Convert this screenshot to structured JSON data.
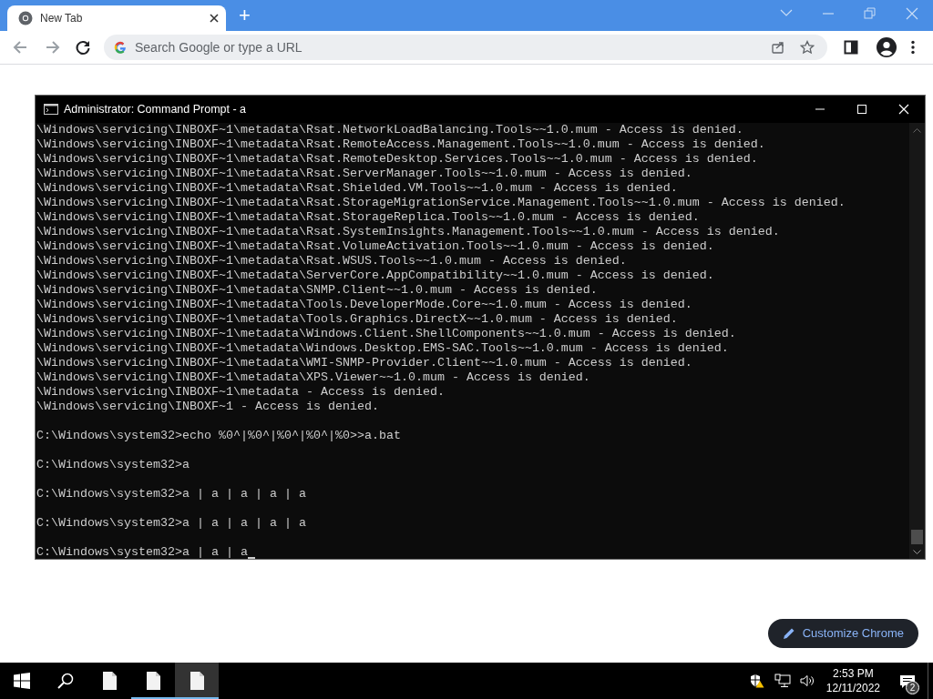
{
  "browser": {
    "tab": {
      "title": "New Tab",
      "selected": true
    },
    "new_tab_button": "+",
    "nav_buttons": [
      {
        "kind": "back",
        "disabled": true
      },
      {
        "kind": "forward",
        "disabled": true
      },
      {
        "kind": "reload",
        "disabled": false
      }
    ],
    "address_bar": {
      "placeholder": "Search Google or type a URL"
    },
    "customize_button": "Customize Chrome"
  },
  "console_window": {
    "title": "Administrator: Command Prompt - a",
    "blocks": [
      [
        "\\Windows\\servicing\\INBOXF~1\\metadata\\Rsat.NetworkLoadBalancing.Tools~~1.0.mum - Access is denied.",
        "\\Windows\\servicing\\INBOXF~1\\metadata\\Rsat.RemoteAccess.Management.Tools~~1.0.mum - Access is denied.",
        "\\Windows\\servicing\\INBOXF~1\\metadata\\Rsat.RemoteDesktop.Services.Tools~~1.0.mum - Access is denied.",
        "\\Windows\\servicing\\INBOXF~1\\metadata\\Rsat.ServerManager.Tools~~1.0.mum - Access is denied.",
        "\\Windows\\servicing\\INBOXF~1\\metadata\\Rsat.Shielded.VM.Tools~~1.0.mum - Access is denied.",
        "\\Windows\\servicing\\INBOXF~1\\metadata\\Rsat.StorageMigrationService.Management.Tools~~1.0.mum - Access is denied.",
        "\\Windows\\servicing\\INBOXF~1\\metadata\\Rsat.StorageReplica.Tools~~1.0.mum - Access is denied.",
        "\\Windows\\servicing\\INBOXF~1\\metadata\\Rsat.SystemInsights.Management.Tools~~1.0.mum - Access is denied.",
        "\\Windows\\servicing\\INBOXF~1\\metadata\\Rsat.VolumeActivation.Tools~~1.0.mum - Access is denied.",
        "\\Windows\\servicing\\INBOXF~1\\metadata\\Rsat.WSUS.Tools~~1.0.mum - Access is denied.",
        "\\Windows\\servicing\\INBOXF~1\\metadata\\ServerCore.AppCompatibility~~1.0.mum - Access is denied.",
        "\\Windows\\servicing\\INBOXF~1\\metadata\\SNMP.Client~~1.0.mum - Access is denied.",
        "\\Windows\\servicing\\INBOXF~1\\metadata\\Tools.DeveloperMode.Core~~1.0.mum - Access is denied.",
        "\\Windows\\servicing\\INBOXF~1\\metadata\\Tools.Graphics.DirectX~~1.0.mum - Access is denied.",
        "\\Windows\\servicing\\INBOXF~1\\metadata\\Windows.Client.ShellComponents~~1.0.mum - Access is denied.",
        "\\Windows\\servicing\\INBOXF~1\\metadata\\Windows.Desktop.EMS-SAC.Tools~~1.0.mum - Access is denied.",
        "\\Windows\\servicing\\INBOXF~1\\metadata\\WMI-SNMP-Provider.Client~~1.0.mum - Access is denied.",
        "\\Windows\\servicing\\INBOXF~1\\metadata\\XPS.Viewer~~1.0.mum - Access is denied.",
        "\\Windows\\servicing\\INBOXF~1\\metadata - Access is denied.",
        "\\Windows\\servicing\\INBOXF~1 - Access is denied."
      ],
      [
        "C:\\Windows\\system32>echo %0^|%0^|%0^|%0^|%0>>a.bat"
      ],
      [
        "C:\\Windows\\system32>a"
      ],
      [
        "C:\\Windows\\system32>a | a | a | a | a"
      ],
      [
        "C:\\Windows\\system32>a | a | a | a | a"
      ],
      [
        "C:\\Windows\\system32>a | a | a"
      ]
    ],
    "cursor_visible": true
  },
  "taskbar": {
    "items": [
      {
        "kind": "start",
        "running": false,
        "selected": false
      },
      {
        "kind": "search",
        "running": false,
        "selected": false
      },
      {
        "kind": "file",
        "running": false,
        "selected": false
      },
      {
        "kind": "file",
        "running": true,
        "selected": false
      },
      {
        "kind": "file",
        "running": true,
        "selected": true
      }
    ],
    "time": "2:53 PM",
    "date": "12/11/2022",
    "notification_count": "2"
  }
}
